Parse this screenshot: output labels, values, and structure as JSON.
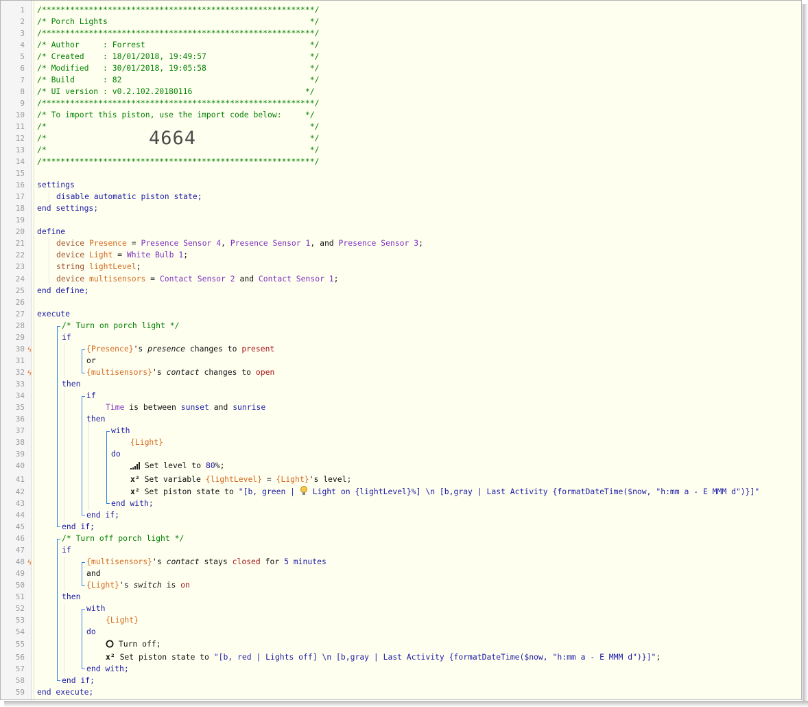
{
  "big_code": "4664",
  "lines": [
    {
      "n": "1"
    },
    {
      "n": "2"
    },
    {
      "n": "3"
    },
    {
      "n": "4"
    },
    {
      "n": "5"
    },
    {
      "n": "6"
    },
    {
      "n": "7"
    },
    {
      "n": "8"
    },
    {
      "n": "9"
    },
    {
      "n": "10"
    },
    {
      "n": "11"
    },
    {
      "n": "12"
    },
    {
      "n": "13"
    },
    {
      "n": "14"
    },
    {
      "n": "15"
    },
    {
      "n": "16"
    },
    {
      "n": "17"
    },
    {
      "n": "18"
    },
    {
      "n": "19"
    },
    {
      "n": "20"
    },
    {
      "n": "21"
    },
    {
      "n": "22"
    },
    {
      "n": "23"
    },
    {
      "n": "24"
    },
    {
      "n": "25"
    },
    {
      "n": "26"
    },
    {
      "n": "27"
    },
    {
      "n": "28"
    },
    {
      "n": "29"
    },
    {
      "n": "30"
    },
    {
      "n": "31"
    },
    {
      "n": "32"
    },
    {
      "n": "33"
    },
    {
      "n": "34"
    },
    {
      "n": "35"
    },
    {
      "n": "36"
    },
    {
      "n": "37"
    },
    {
      "n": "38"
    },
    {
      "n": "39"
    },
    {
      "n": "40"
    },
    {
      "n": "41"
    },
    {
      "n": "42"
    },
    {
      "n": "43"
    },
    {
      "n": "44"
    },
    {
      "n": "45"
    },
    {
      "n": "46"
    },
    {
      "n": "47"
    },
    {
      "n": "48"
    },
    {
      "n": "49"
    },
    {
      "n": "50"
    },
    {
      "n": "51"
    },
    {
      "n": "52"
    },
    {
      "n": "53"
    },
    {
      "n": "54"
    },
    {
      "n": "55"
    },
    {
      "n": "56"
    },
    {
      "n": "57"
    },
    {
      "n": "58"
    },
    {
      "n": "59"
    }
  ],
  "header": {
    "border": "/**********************************************************/",
    "title": "/* Porch Lights                                           */",
    "author": "/* Author     : Forrest                                   */",
    "created": "/* Created    : 18/01/2018, 19:49:57                      */",
    "modified": "/* Modified   : 30/01/2018, 19:05:58                      */",
    "build": "/* Build      : 82                                        */",
    "ui_version": "/* UI version : v0.2.102.20180116                        */",
    "import_note": "/* To import this piston, use the import code below:     */",
    "blank": "/*                                                        */"
  },
  "tok": {
    "settings": "settings",
    "disable_state": "disable automatic piston state;",
    "end_settings": "end settings;",
    "define": "define",
    "device": "device",
    "string": "string",
    "presence_var": "Presence",
    "light_var": "Light",
    "lightlevel_var": "lightLevel",
    "multisensors_var": "multisensors",
    "eq": " = ",
    "semicolon": ";",
    "comma": ", ",
    "and_word": "and",
    "presence_sensor_4": "Presence Sensor 4",
    "presence_sensor_1": "Presence Sensor 1",
    "presence_sensor_3": "Presence Sensor 3",
    "comma_and": ", and ",
    "white_bulb_1": "White Bulb 1",
    "contact_sensor_2": "Contact Sensor 2",
    "contact_sensor_1": "Contact Sensor 1",
    "end_define": "end define;",
    "execute": "execute",
    "comment_on": "/* Turn on porch light */",
    "comment_off": "/* Turn off porch light */",
    "if": "if",
    "then": "then",
    "or": "or",
    "with": "with",
    "do": "do",
    "end_if": "end if;",
    "end_with": "end with;",
    "end_execute": "end execute;",
    "presence_ref": "{Presence}",
    "multisensors_ref": "{multisensors}",
    "light_ref": "{Light}",
    "lightlevel_ref": "{lightLevel}",
    "apos_s": "'s ",
    "attr_presence": "presence",
    "attr_contact": "contact",
    "attr_switch": "switch",
    "changes_to": " changes to ",
    "present": "present",
    "open": "open",
    "time": "Time",
    "is_between": " is between ",
    "sunset": "sunset",
    "sunrise": "sunrise",
    "set_level_to": " Set level to ",
    "level_value": "80",
    "percent": "%;",
    "set_variable": " Set variable ",
    "level_attr": "'s level;",
    "set_state_to": " Set piston state to ",
    "state_on_a": "\"[b, green | ",
    "state_on_b": " Light on {lightLevel}%] \\n [b,gray | Last Activity {formatDateTime($now, \"h:mm a - E MMM d\")}]\"",
    "stays": " stays ",
    "closed": "closed",
    "for": " for ",
    "five_minutes": "5 minutes",
    "is": " is ",
    "on": "on",
    "turn_off": " Turn off;",
    "state_off": "\"[b, red | Lights off] \\n [b,gray | Last Activity {formatDateTime($now, \"h:mm a - E MMM d\")}]\""
  },
  "icons": {
    "trigger": "lightning-bolt-icon",
    "level": "signal-level-icon",
    "variable": "x-squared-icon",
    "bulb": "light-bulb-icon",
    "power": "power-off-icon",
    "trigger_color": "#e8762c",
    "bracket_color": "#2f7fe5"
  }
}
